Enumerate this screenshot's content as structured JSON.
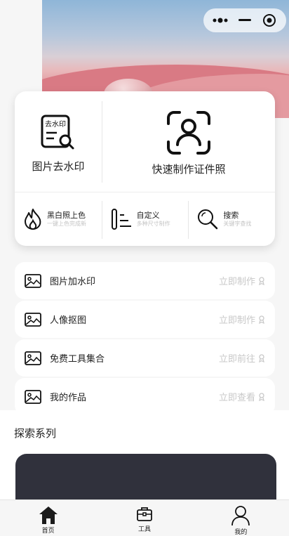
{
  "top_actions": {
    "more_icon": "more-dots-icon",
    "minimize_icon": "minimize-icon",
    "close_icon": "target-close-icon"
  },
  "feature_card": {
    "watermark_remove": {
      "label": "图片去水印",
      "icon_text": "去水印"
    },
    "id_photo": {
      "label": "快速制作证件照"
    },
    "small_tools": [
      {
        "title": "黑白照上色",
        "subtitle": "一键上色完成新",
        "icon": "flame-icon"
      },
      {
        "title": "自定义",
        "subtitle": "多种尺寸制作",
        "icon": "custom-size-icon"
      },
      {
        "title": "搜索",
        "subtitle": "关键字查找",
        "icon": "search-icon"
      }
    ]
  },
  "tool_list": [
    {
      "label": "图片加水印",
      "action": "立即制作"
    },
    {
      "label": "人像抠图",
      "action": "立即制作"
    },
    {
      "label": "免费工具集合",
      "action": "立即前往"
    },
    {
      "label": "我的作品",
      "action": "立即查看"
    }
  ],
  "explore": {
    "title": "探索系列"
  },
  "tabbar": {
    "items": [
      {
        "label": "首页",
        "icon": "home-icon"
      },
      {
        "label": "工具",
        "icon": "toolbox-icon"
      },
      {
        "label": "我的",
        "icon": "user-icon"
      }
    ]
  },
  "colors": {
    "accent_dark": "#30313c",
    "muted_text": "#c8c8c8",
    "background": "#f6f6f6"
  }
}
